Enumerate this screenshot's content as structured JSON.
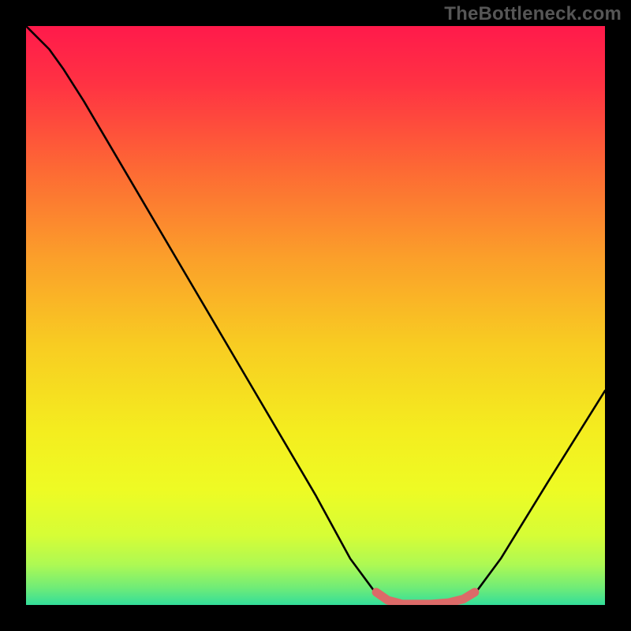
{
  "watermark": "TheBottleneck.com",
  "chart_data": {
    "type": "line",
    "title": "",
    "xlabel": "",
    "ylabel": "",
    "xlim": [
      0,
      100
    ],
    "ylim": [
      0,
      100
    ],
    "grid": false,
    "curve": {
      "name": "bottleneck-curve",
      "points_pct": [
        [
          0.0,
          100.0
        ],
        [
          4.0,
          96.0
        ],
        [
          6.5,
          92.5
        ],
        [
          10.0,
          87.0
        ],
        [
          20.0,
          70.0
        ],
        [
          30.0,
          53.0
        ],
        [
          40.0,
          36.0
        ],
        [
          50.0,
          19.0
        ],
        [
          56.0,
          8.0
        ],
        [
          60.0,
          2.6
        ],
        [
          63.0,
          0.6
        ],
        [
          66.0,
          0.0
        ],
        [
          72.0,
          0.0
        ],
        [
          75.0,
          0.6
        ],
        [
          78.0,
          2.6
        ],
        [
          82.0,
          8.0
        ],
        [
          90.0,
          21.0
        ],
        [
          100.0,
          37.0
        ]
      ]
    },
    "highlight": {
      "name": "optimal-band",
      "color": "#dc6a68",
      "points_pct": [
        [
          60.5,
          2.2
        ],
        [
          62.5,
          0.8
        ],
        [
          65.0,
          0.15
        ],
        [
          70.0,
          0.15
        ],
        [
          73.0,
          0.4
        ],
        [
          75.5,
          1.0
        ],
        [
          77.5,
          2.2
        ]
      ]
    },
    "background_gradient": {
      "type": "vertical",
      "stops": [
        {
          "pos": 0.0,
          "color": "#ff1a4b"
        },
        {
          "pos": 0.1,
          "color": "#ff3243"
        },
        {
          "pos": 0.25,
          "color": "#fd6a34"
        },
        {
          "pos": 0.4,
          "color": "#fb9f2a"
        },
        {
          "pos": 0.55,
          "color": "#f8cc22"
        },
        {
          "pos": 0.7,
          "color": "#f4ed1f"
        },
        {
          "pos": 0.8,
          "color": "#eefb24"
        },
        {
          "pos": 0.88,
          "color": "#d6fd36"
        },
        {
          "pos": 0.93,
          "color": "#aef953"
        },
        {
          "pos": 0.97,
          "color": "#70ec77"
        },
        {
          "pos": 1.0,
          "color": "#33de9a"
        }
      ]
    }
  }
}
